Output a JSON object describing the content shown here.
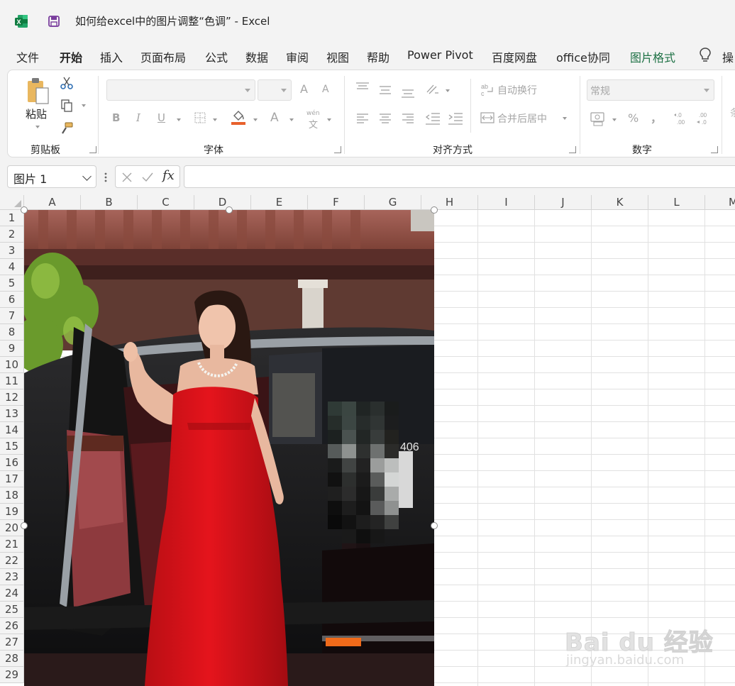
{
  "window": {
    "title": "如何给excel中的图片调整“色调”  -  Excel",
    "icons": [
      "excel-logo-icon",
      "save-icon"
    ]
  },
  "menu": {
    "items": [
      "文件",
      "开始",
      "插入",
      "页面布局",
      "公式",
      "数据",
      "审阅",
      "视图",
      "帮助",
      "Power Pivot",
      "百度网盘",
      "office协同",
      "图片格式",
      "操"
    ],
    "active": "开始"
  },
  "ribbon": {
    "clipboard": {
      "paste_label": "粘贴",
      "group_label": "剪贴板"
    },
    "font": {
      "group_label": "字体",
      "bold": "B",
      "italic": "I",
      "underline": "U",
      "font_color": "A",
      "phonetic": "wén",
      "grow": "A",
      "shrink": "A"
    },
    "alignment": {
      "group_label": "对齐方式",
      "wrap_text": "自动换行",
      "merge_center": "合并后居中"
    },
    "number": {
      "group_label": "数字",
      "format_value": "常规",
      "percent": "%",
      "comma": "，"
    }
  },
  "formula_bar": {
    "name_box": "图片 1",
    "fx": "fx",
    "value": ""
  },
  "sheet": {
    "columns": [
      "A",
      "B",
      "C",
      "D",
      "E",
      "F",
      "G",
      "H",
      "I",
      "J",
      "K",
      "L",
      "M"
    ],
    "rows": [
      "1",
      "2",
      "3",
      "4",
      "5",
      "6",
      "7",
      "8",
      "9",
      "10",
      "11",
      "12",
      "13",
      "14",
      "15",
      "16",
      "17",
      "18",
      "19",
      "20",
      "21",
      "22",
      "23",
      "24",
      "25",
      "26",
      "27",
      "28",
      "29"
    ],
    "picture_plate_text": "406"
  },
  "watermark": {
    "main": "Bai du 经验",
    "sub": "jingyan.baidu.com"
  }
}
